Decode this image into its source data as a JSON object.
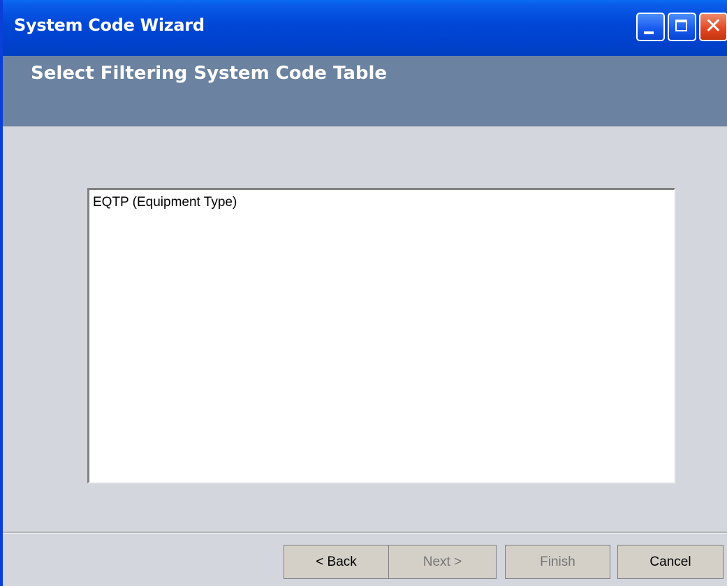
{
  "window": {
    "title": "System Code Wizard"
  },
  "header": {
    "title": "Select Filtering System Code Table"
  },
  "list": {
    "items": [
      "EQTP (Equipment Type)"
    ]
  },
  "buttons": {
    "back": "< Back",
    "next": "Next >",
    "finish": "Finish",
    "cancel": "Cancel"
  },
  "colors": {
    "titlebar": "#0047d6",
    "header": "#6b83a1",
    "body": "#d3d6dc",
    "close_button": "#e0461f"
  },
  "icons": {
    "minimize": "minimize-icon",
    "maximize": "maximize-icon",
    "close": "close-icon"
  }
}
